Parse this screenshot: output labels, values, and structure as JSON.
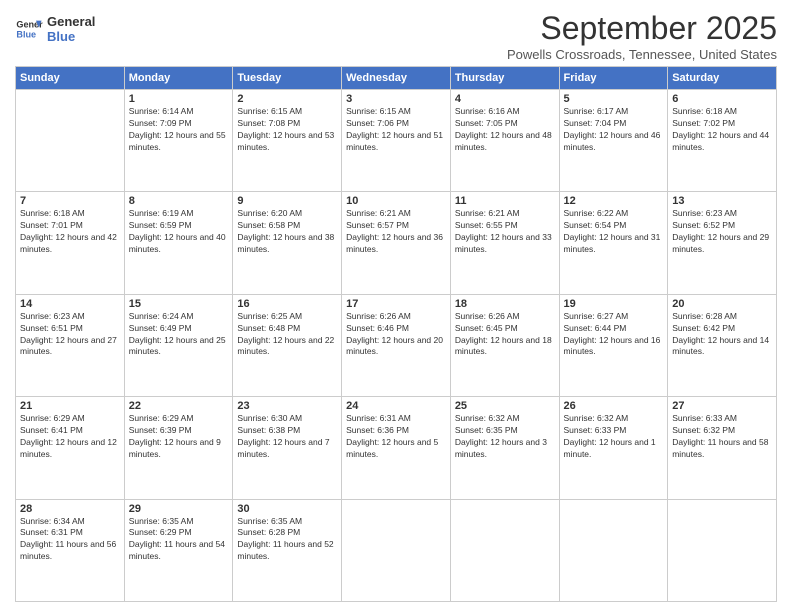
{
  "logo": {
    "line1": "General",
    "line2": "Blue"
  },
  "title": "September 2025",
  "subtitle": "Powells Crossroads, Tennessee, United States",
  "weekdays": [
    "Sunday",
    "Monday",
    "Tuesday",
    "Wednesday",
    "Thursday",
    "Friday",
    "Saturday"
  ],
  "weeks": [
    [
      {
        "day": "",
        "sunrise": "",
        "sunset": "",
        "daylight": ""
      },
      {
        "day": "1",
        "sunrise": "Sunrise: 6:14 AM",
        "sunset": "Sunset: 7:09 PM",
        "daylight": "Daylight: 12 hours and 55 minutes."
      },
      {
        "day": "2",
        "sunrise": "Sunrise: 6:15 AM",
        "sunset": "Sunset: 7:08 PM",
        "daylight": "Daylight: 12 hours and 53 minutes."
      },
      {
        "day": "3",
        "sunrise": "Sunrise: 6:15 AM",
        "sunset": "Sunset: 7:06 PM",
        "daylight": "Daylight: 12 hours and 51 minutes."
      },
      {
        "day": "4",
        "sunrise": "Sunrise: 6:16 AM",
        "sunset": "Sunset: 7:05 PM",
        "daylight": "Daylight: 12 hours and 48 minutes."
      },
      {
        "day": "5",
        "sunrise": "Sunrise: 6:17 AM",
        "sunset": "Sunset: 7:04 PM",
        "daylight": "Daylight: 12 hours and 46 minutes."
      },
      {
        "day": "6",
        "sunrise": "Sunrise: 6:18 AM",
        "sunset": "Sunset: 7:02 PM",
        "daylight": "Daylight: 12 hours and 44 minutes."
      }
    ],
    [
      {
        "day": "7",
        "sunrise": "Sunrise: 6:18 AM",
        "sunset": "Sunset: 7:01 PM",
        "daylight": "Daylight: 12 hours and 42 minutes."
      },
      {
        "day": "8",
        "sunrise": "Sunrise: 6:19 AM",
        "sunset": "Sunset: 6:59 PM",
        "daylight": "Daylight: 12 hours and 40 minutes."
      },
      {
        "day": "9",
        "sunrise": "Sunrise: 6:20 AM",
        "sunset": "Sunset: 6:58 PM",
        "daylight": "Daylight: 12 hours and 38 minutes."
      },
      {
        "day": "10",
        "sunrise": "Sunrise: 6:21 AM",
        "sunset": "Sunset: 6:57 PM",
        "daylight": "Daylight: 12 hours and 36 minutes."
      },
      {
        "day": "11",
        "sunrise": "Sunrise: 6:21 AM",
        "sunset": "Sunset: 6:55 PM",
        "daylight": "Daylight: 12 hours and 33 minutes."
      },
      {
        "day": "12",
        "sunrise": "Sunrise: 6:22 AM",
        "sunset": "Sunset: 6:54 PM",
        "daylight": "Daylight: 12 hours and 31 minutes."
      },
      {
        "day": "13",
        "sunrise": "Sunrise: 6:23 AM",
        "sunset": "Sunset: 6:52 PM",
        "daylight": "Daylight: 12 hours and 29 minutes."
      }
    ],
    [
      {
        "day": "14",
        "sunrise": "Sunrise: 6:23 AM",
        "sunset": "Sunset: 6:51 PM",
        "daylight": "Daylight: 12 hours and 27 minutes."
      },
      {
        "day": "15",
        "sunrise": "Sunrise: 6:24 AM",
        "sunset": "Sunset: 6:49 PM",
        "daylight": "Daylight: 12 hours and 25 minutes."
      },
      {
        "day": "16",
        "sunrise": "Sunrise: 6:25 AM",
        "sunset": "Sunset: 6:48 PM",
        "daylight": "Daylight: 12 hours and 22 minutes."
      },
      {
        "day": "17",
        "sunrise": "Sunrise: 6:26 AM",
        "sunset": "Sunset: 6:46 PM",
        "daylight": "Daylight: 12 hours and 20 minutes."
      },
      {
        "day": "18",
        "sunrise": "Sunrise: 6:26 AM",
        "sunset": "Sunset: 6:45 PM",
        "daylight": "Daylight: 12 hours and 18 minutes."
      },
      {
        "day": "19",
        "sunrise": "Sunrise: 6:27 AM",
        "sunset": "Sunset: 6:44 PM",
        "daylight": "Daylight: 12 hours and 16 minutes."
      },
      {
        "day": "20",
        "sunrise": "Sunrise: 6:28 AM",
        "sunset": "Sunset: 6:42 PM",
        "daylight": "Daylight: 12 hours and 14 minutes."
      }
    ],
    [
      {
        "day": "21",
        "sunrise": "Sunrise: 6:29 AM",
        "sunset": "Sunset: 6:41 PM",
        "daylight": "Daylight: 12 hours and 12 minutes."
      },
      {
        "day": "22",
        "sunrise": "Sunrise: 6:29 AM",
        "sunset": "Sunset: 6:39 PM",
        "daylight": "Daylight: 12 hours and 9 minutes."
      },
      {
        "day": "23",
        "sunrise": "Sunrise: 6:30 AM",
        "sunset": "Sunset: 6:38 PM",
        "daylight": "Daylight: 12 hours and 7 minutes."
      },
      {
        "day": "24",
        "sunrise": "Sunrise: 6:31 AM",
        "sunset": "Sunset: 6:36 PM",
        "daylight": "Daylight: 12 hours and 5 minutes."
      },
      {
        "day": "25",
        "sunrise": "Sunrise: 6:32 AM",
        "sunset": "Sunset: 6:35 PM",
        "daylight": "Daylight: 12 hours and 3 minutes."
      },
      {
        "day": "26",
        "sunrise": "Sunrise: 6:32 AM",
        "sunset": "Sunset: 6:33 PM",
        "daylight": "Daylight: 12 hours and 1 minute."
      },
      {
        "day": "27",
        "sunrise": "Sunrise: 6:33 AM",
        "sunset": "Sunset: 6:32 PM",
        "daylight": "Daylight: 11 hours and 58 minutes."
      }
    ],
    [
      {
        "day": "28",
        "sunrise": "Sunrise: 6:34 AM",
        "sunset": "Sunset: 6:31 PM",
        "daylight": "Daylight: 11 hours and 56 minutes."
      },
      {
        "day": "29",
        "sunrise": "Sunrise: 6:35 AM",
        "sunset": "Sunset: 6:29 PM",
        "daylight": "Daylight: 11 hours and 54 minutes."
      },
      {
        "day": "30",
        "sunrise": "Sunrise: 6:35 AM",
        "sunset": "Sunset: 6:28 PM",
        "daylight": "Daylight: 11 hours and 52 minutes."
      },
      {
        "day": "",
        "sunrise": "",
        "sunset": "",
        "daylight": ""
      },
      {
        "day": "",
        "sunrise": "",
        "sunset": "",
        "daylight": ""
      },
      {
        "day": "",
        "sunrise": "",
        "sunset": "",
        "daylight": ""
      },
      {
        "day": "",
        "sunrise": "",
        "sunset": "",
        "daylight": ""
      }
    ]
  ]
}
